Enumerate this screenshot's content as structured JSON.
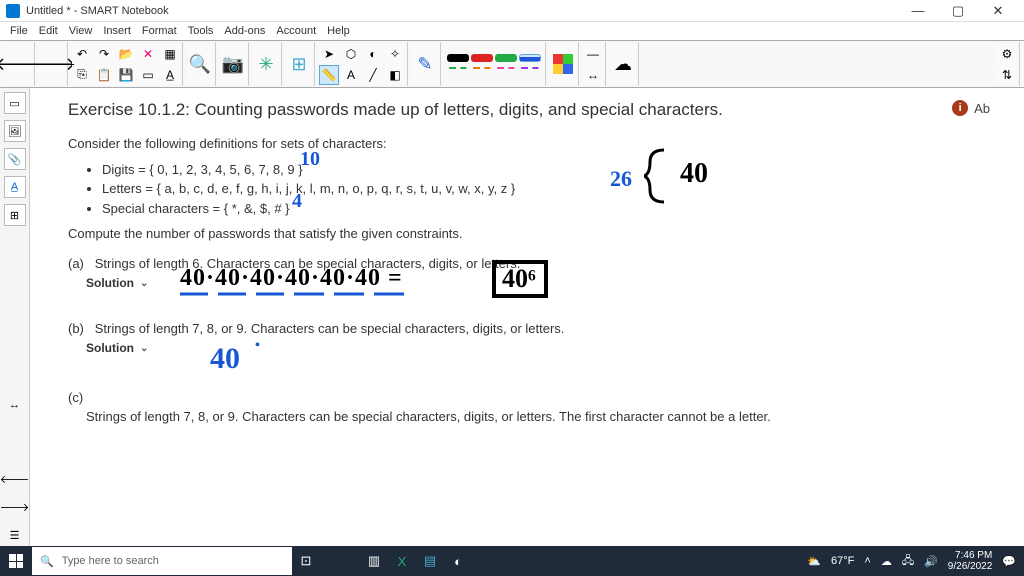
{
  "window": {
    "title": "Untitled * - SMART Notebook"
  },
  "menu": [
    "File",
    "Edit",
    "View",
    "Insert",
    "Format",
    "Tools",
    "Add-ons",
    "Account",
    "Help"
  ],
  "info_badge": "Ab",
  "exercise": {
    "title": "Exercise 10.1.2: Counting passwords made up of letters, digits, and special characters.",
    "intro": "Consider the following definitions for sets of characters:",
    "bullets": [
      "Digits = { 0, 1, 2, 3, 4, 5, 6, 7, 8, 9 }",
      "Letters = { a, b, c, d, e, f, g, h, i, j, k, l, m, n, o, p, q, r, s, t, u, v, w, x, y, z }",
      "Special characters = { *, &, $, # }"
    ],
    "compute": "Compute the number of passwords that satisfy the given constraints.",
    "a_label": "(a)",
    "a_text": "Strings of length 6. Characters can be special characters, digits, or letters.",
    "solution_label": "Solution",
    "b_label": "(b)",
    "b_text": "Strings of length 7, 8, or 9. Characters can be special characters, digits, or letters.",
    "c_label": "(c)",
    "c_text": "Strings of length 7, 8, or 9. Characters can be special characters, digits, or letters. The first character cannot be a letter."
  },
  "handwriting": {
    "digits_count": "10",
    "letters_count": "26",
    "special_count": "4",
    "total": "40",
    "eq_a": "40·40·40·40·40·40 =",
    "ans_a": "40⁶",
    "ans_b": "40"
  },
  "search_placeholder": "Type here to search",
  "weather": "67°F",
  "clock": {
    "time": "7:46 PM",
    "date": "9/26/2022"
  }
}
